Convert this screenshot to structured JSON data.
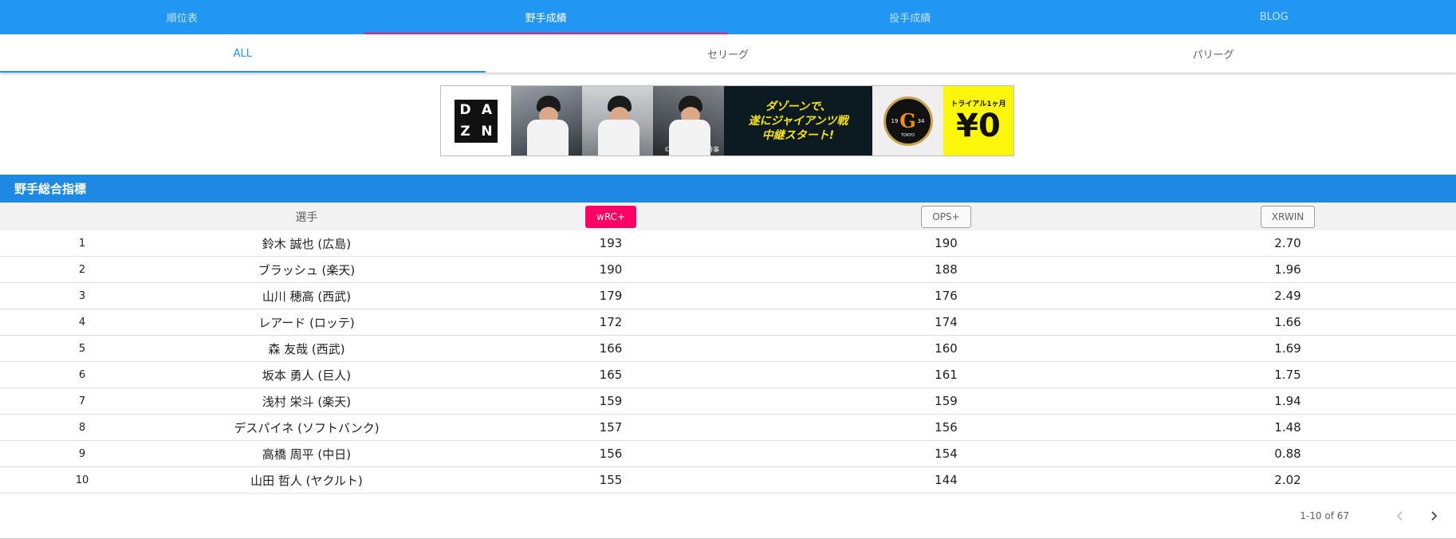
{
  "topnav": {
    "tabs": [
      {
        "label": "順位表",
        "active": false
      },
      {
        "label": "野手成績",
        "active": true
      },
      {
        "label": "投手成績",
        "active": false
      },
      {
        "label": "BLOG",
        "active": false
      }
    ]
  },
  "subnav": {
    "tabs": [
      {
        "label": "ALL",
        "active": true
      },
      {
        "label": "セリーグ",
        "active": false
      },
      {
        "label": "パリーグ",
        "active": false
      }
    ]
  },
  "banner": {
    "dazn_letters": [
      "D",
      "A",
      "Z",
      "N"
    ],
    "photo_credit": "© 読売巨人軍 時事",
    "slogan_line1": "ダゾーンで、",
    "slogan_line2": "遂にジャイアンツ戦",
    "slogan_line3": "中継スタート!",
    "logo_year_left": "19",
    "logo_year_right": "34",
    "logo_letter": "G",
    "logo_city": "TOKYO",
    "trial_text": "トライアル1ヶ月",
    "trial_price": "¥0"
  },
  "section": {
    "title": "野手総合指標"
  },
  "table": {
    "headers": {
      "player": "選手",
      "wrc": "wRC+",
      "ops": "OPS+",
      "xrwin": "XRWIN"
    },
    "rows": [
      {
        "rank": "1",
        "player": "鈴木 誠也 (広島)",
        "wrc": "193",
        "ops": "190",
        "xrwin": "2.70"
      },
      {
        "rank": "2",
        "player": "ブラッシュ (楽天)",
        "wrc": "190",
        "ops": "188",
        "xrwin": "1.96"
      },
      {
        "rank": "3",
        "player": "山川 穂高 (西武)",
        "wrc": "179",
        "ops": "176",
        "xrwin": "2.49"
      },
      {
        "rank": "4",
        "player": "レアード (ロッテ)",
        "wrc": "172",
        "ops": "174",
        "xrwin": "1.66"
      },
      {
        "rank": "5",
        "player": "森 友哉 (西武)",
        "wrc": "166",
        "ops": "160",
        "xrwin": "1.69"
      },
      {
        "rank": "6",
        "player": "坂本 勇人 (巨人)",
        "wrc": "165",
        "ops": "161",
        "xrwin": "1.75"
      },
      {
        "rank": "7",
        "player": "浅村 栄斗 (楽天)",
        "wrc": "159",
        "ops": "159",
        "xrwin": "1.94"
      },
      {
        "rank": "8",
        "player": "デスパイネ (ソフトバンク)",
        "wrc": "157",
        "ops": "156",
        "xrwin": "1.48"
      },
      {
        "rank": "9",
        "player": "高橋 周平 (中日)",
        "wrc": "156",
        "ops": "154",
        "xrwin": "0.88"
      },
      {
        "rank": "10",
        "player": "山田 哲人 (ヤクルト)",
        "wrc": "155",
        "ops": "144",
        "xrwin": "2.02"
      }
    ]
  },
  "pagination": {
    "range_text": "1-10 of 67",
    "prev_icon": "chevron-left-icon",
    "next_icon": "chevron-right-icon"
  },
  "colors": {
    "primary": "#2196f3",
    "section_header": "#1e88e5",
    "active_accent": "#ff0066",
    "tab_indicator": "#ff1470"
  }
}
